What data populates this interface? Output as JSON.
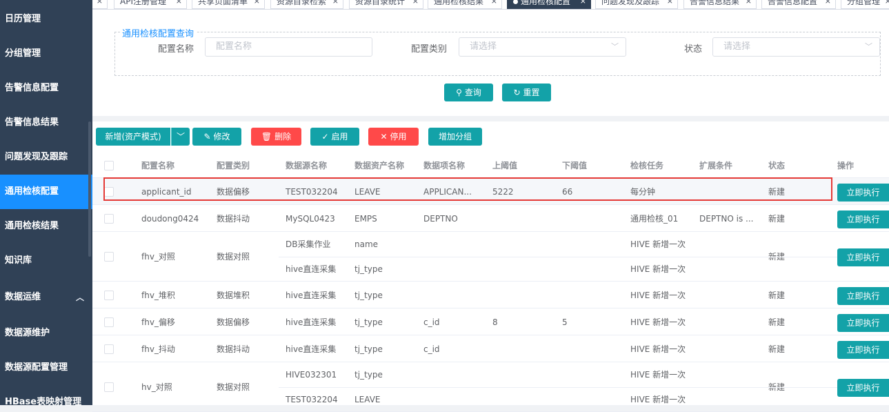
{
  "sidebar": {
    "items": [
      {
        "label": "日历管理"
      },
      {
        "label": "分组管理"
      },
      {
        "label": "告警信息配置"
      },
      {
        "label": "告警信息结果"
      },
      {
        "label": "问题发现及跟踪"
      },
      {
        "label": "通用检核配置",
        "active": true
      },
      {
        "label": "通用检核结果"
      },
      {
        "label": "知识库"
      },
      {
        "label": "数据运维",
        "expand_icon": "chevron-up-icon"
      },
      {
        "label": "数据源维护"
      },
      {
        "label": "数据源配置管理"
      },
      {
        "label": "HBase表映射管理"
      }
    ]
  },
  "tabs": [
    {
      "label": "API注册管理"
    },
    {
      "label": "共享页面清单"
    },
    {
      "label": "资源目录检索"
    },
    {
      "label": "资源目录统计"
    },
    {
      "label": "通用检核结果"
    },
    {
      "label": "通用检核配置",
      "active": true
    },
    {
      "label": "问题发现及跟踪"
    },
    {
      "label": "告警信息结果"
    },
    {
      "label": "告警信息配置"
    },
    {
      "label": "分组管理"
    }
  ],
  "query": {
    "legend": "通用检核配置查询",
    "name_label": "配置名称",
    "name_placeholder": "配置名称",
    "type_label": "配置类别",
    "type_placeholder": "请选择",
    "status_label": "状态",
    "status_placeholder": "请选择",
    "search_label": "查询",
    "reset_label": "重置"
  },
  "toolbar": {
    "add_label": "新增(资产模式)",
    "edit_label": "修改",
    "delete_label": "删除",
    "enable_label": "启用",
    "disable_label": "停用",
    "group_label": "增加分组"
  },
  "table": {
    "columns": [
      "配置名称",
      "配置类别",
      "数据源名称",
      "数据资产名称",
      "数据项名称",
      "上阈值",
      "下阈值",
      "检核任务",
      "扩展条件",
      "状态",
      "操作"
    ],
    "action_label": "立即执行",
    "rows": [
      {
        "name": "applicant_id",
        "type": "数据偏移",
        "subs": [
          {
            "source": "TEST032204",
            "asset": "LEAVE",
            "item": "APPLICAN...",
            "task": "每分钟"
          }
        ],
        "upper": "5222",
        "lower": "66",
        "ext": "",
        "status": "新建",
        "highlight": true
      },
      {
        "name": "doudong0424",
        "type": "数据抖动",
        "subs": [
          {
            "source": "MySQL0423",
            "asset": "EMPS",
            "item": "DEPTNO",
            "task": "通用检核_01"
          }
        ],
        "upper": "",
        "lower": "",
        "ext": "DEPTNO is ...",
        "status": "新建"
      },
      {
        "name": "fhv_对照",
        "type": "数据对照",
        "subs": [
          {
            "source": "DB采集作业",
            "asset": "name",
            "item": "",
            "task": "HIVE 新增一次"
          },
          {
            "source": "hive直连采集",
            "asset": "tj_type",
            "item": "",
            "task": "HIVE 新增一次"
          }
        ],
        "upper": "",
        "lower": "",
        "ext": "",
        "status": "新建"
      },
      {
        "name": "fhv_堆积",
        "type": "数据堆积",
        "subs": [
          {
            "source": "hive直连采集",
            "asset": "tj_type",
            "item": "",
            "task": "HIVE 新增一次"
          }
        ],
        "upper": "",
        "lower": "",
        "ext": "",
        "status": "新建"
      },
      {
        "name": "fhv_偏移",
        "type": "数据偏移",
        "subs": [
          {
            "source": "hive直连采集",
            "asset": "tj_type",
            "item": "c_id",
            "task": "HIVE 新增一次"
          }
        ],
        "upper": "8",
        "lower": "5",
        "ext": "",
        "status": "新建"
      },
      {
        "name": "fhv_抖动",
        "type": "数据抖动",
        "subs": [
          {
            "source": "hive直连采集",
            "asset": "tj_type",
            "item": "c_id",
            "task": "HIVE 新增一次"
          }
        ],
        "upper": "",
        "lower": "",
        "ext": "",
        "status": "新建"
      },
      {
        "name": "hv_对照",
        "type": "数据对照",
        "subs": [
          {
            "source": "HIVE032301",
            "asset": "tj_type",
            "item": "",
            "task": "HIVE 新增一次"
          },
          {
            "source": "TEST032204",
            "asset": "LEAVE",
            "item": "",
            "task": "HIVE 新增一次"
          }
        ],
        "upper": "",
        "lower": "",
        "ext": "",
        "status": "新建"
      }
    ]
  },
  "colors": {
    "sidebar_bg": "#304156",
    "active_blue": "#1890ff",
    "teal": "#13a2a8",
    "danger": "#ff4949",
    "highlight_border": "#e53935"
  }
}
